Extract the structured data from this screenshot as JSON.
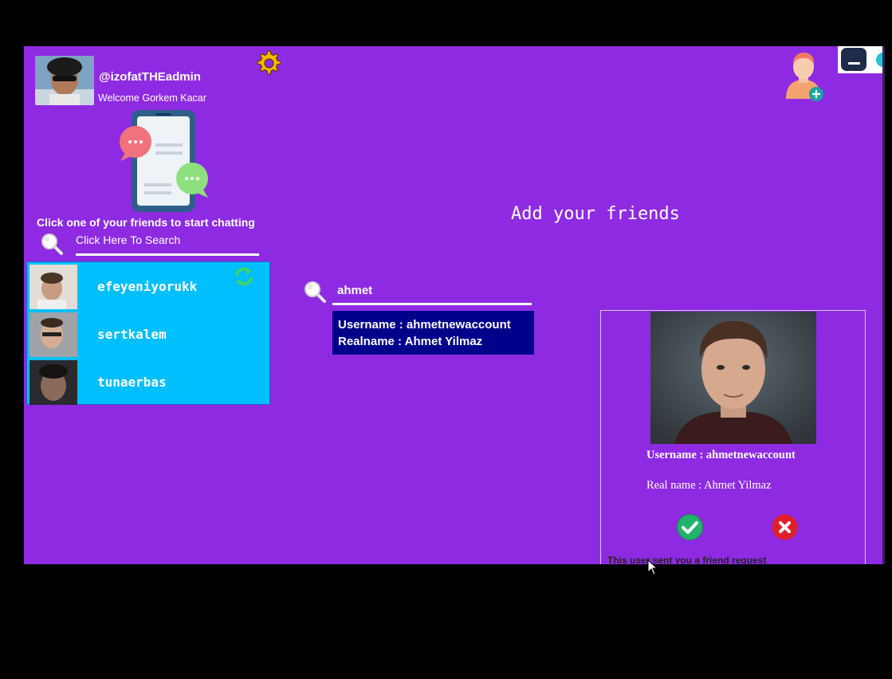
{
  "header": {
    "username": "@izofatTHEadmin",
    "welcome": "Welcome Gorkem Kacar"
  },
  "sidebar": {
    "hint": "Click one of your friends to start chatting",
    "search_placeholder": "Click Here To Search",
    "friends": [
      {
        "name": "efeyeniyorukk"
      },
      {
        "name": "sertkalem"
      },
      {
        "name": "tunaerbas"
      }
    ]
  },
  "main": {
    "heading": "Add your friends",
    "search_value": "ahmet",
    "result": {
      "username_line": "Username : ahmetnewaccount",
      "realname_line": "Realname : Ahmet Yilmaz"
    }
  },
  "request_card": {
    "username_line": "Username : ahmetnewaccount",
    "realname_line": "Real name : Ahmet Yilmaz",
    "note": "This user sent you a friend request"
  },
  "colors": {
    "background": "#8e2be2",
    "friend_list": "#00bfff",
    "result_box": "#00008b",
    "accept": "#21b36b",
    "reject": "#e01e2a"
  },
  "icons": [
    "gear-icon",
    "search-icon",
    "refresh-icon",
    "add-friend-icon",
    "check-icon",
    "close-icon",
    "minimize-icon"
  ]
}
